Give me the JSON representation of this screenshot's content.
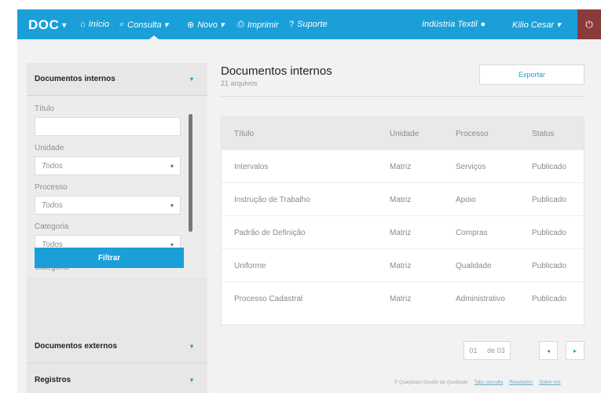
{
  "topbar": {
    "logo": "DOC",
    "logo_caret": "▾",
    "nav": [
      {
        "icon": "⌂",
        "label": "Início"
      },
      {
        "icon": "⌕",
        "label": "Consulta ▾"
      },
      {
        "icon": "⊕",
        "label": "Novo ▾"
      },
      {
        "icon": "⎙",
        "label": "Imprimir"
      },
      {
        "icon": "?",
        "label": "Suporte"
      }
    ],
    "company": "Indústria Textil",
    "company_icon": "●",
    "user": "Kilio Cesar ▾",
    "power_icon": "⏻"
  },
  "sidebar": {
    "section_internal": "Documentos internos",
    "section_external": "Documentos externos",
    "section_records": "Registros",
    "caret": "▾",
    "labels": {
      "titulo": "Título",
      "unidade": "Unidade",
      "processo": "Processo",
      "categoria": "Categoria",
      "categoria2": "Categoria"
    },
    "selects": {
      "unidade": "Todos",
      "processo": "Todos",
      "categoria": "Todos"
    },
    "dropdown_arrow": "▾",
    "filter_button": "Filtrar"
  },
  "main": {
    "title": "Documentos internos",
    "subtitle": "21 arquivos",
    "export_button": "Exportar",
    "columns": [
      "Título",
      "Unidade",
      "Processo",
      "Status"
    ],
    "rows": [
      [
        "Intervalos",
        "Matriz",
        "Serviços",
        "Publicado"
      ],
      [
        "Instrução de Trabalho",
        "Matriz",
        "Apoio",
        "Publicado"
      ],
      [
        "Padrão de Definição",
        "Matriz",
        "Compras",
        "Publicado"
      ],
      [
        "Uniforme",
        "Matriz",
        "Qualidade",
        "Publicado"
      ],
      [
        "Processo Cadastral",
        "Matriz",
        "Administrativo",
        "Publicado"
      ]
    ]
  },
  "pagination": {
    "current": "01",
    "total": "de 03",
    "prev": "◂",
    "next": "▸"
  },
  "footer": {
    "copyright": "© Qualyteam Gestão da Qualidade",
    "links": [
      "Tabs consulta",
      "Resultados",
      "Sobre nós"
    ]
  },
  "colors": {
    "accent": "#1a9fd9",
    "power": "#8a3a3a",
    "sidebar_bg": "#e7e7e7",
    "page_bg": "#f2f2f2"
  }
}
